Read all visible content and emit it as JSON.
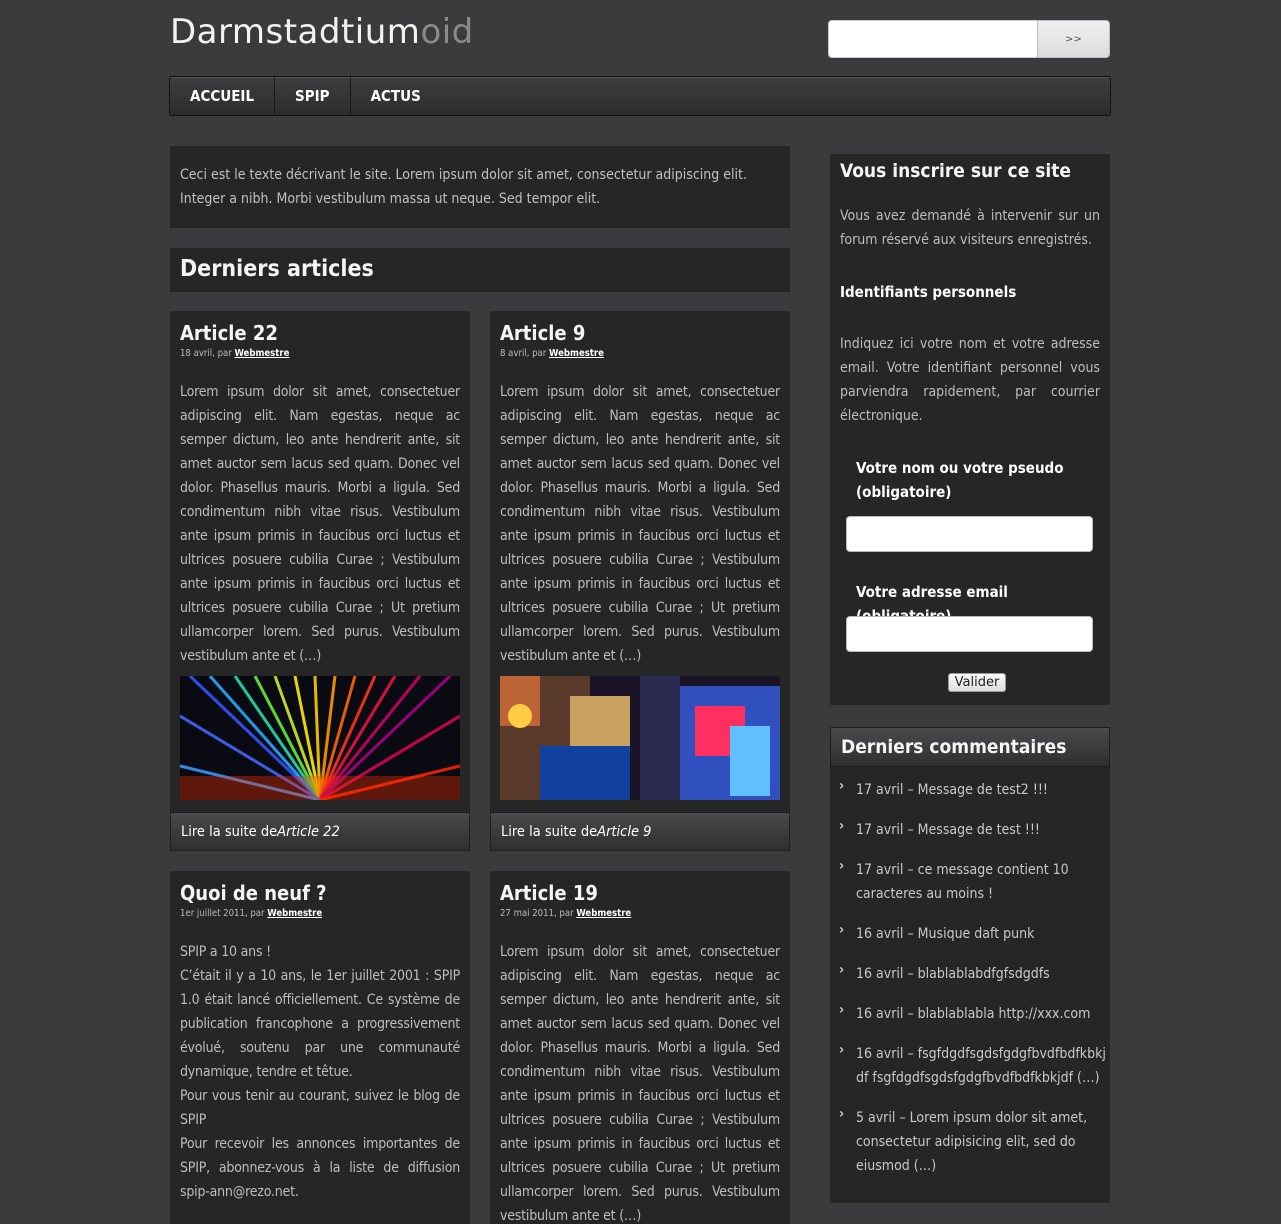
{
  "site": {
    "title_main": "Darmstadtium",
    "title_light": "oid",
    "search_button": ">>"
  },
  "nav": [
    "ACCUEIL",
    "SPIP",
    "ACTUS"
  ],
  "description": "Ceci est le texte décrivant le site. Lorem ipsum dolor sit amet, consectetur adipiscing elit. Integer a nibh. Morbi vestibulum massa ut neque. Sed tempor elit.",
  "section_title": "Derniers articles",
  "articles": [
    {
      "title": "Article 22",
      "date": "18 avril, par ",
      "author": "Webmestre",
      "text": "Lorem ipsum dolor sit amet, consectetuer adipiscing elit. Nam egestas, neque ac semper dictum, leo ante hendrerit ante, sit amet auctor sem lacus sed quam. Donec vel dolor. Phasellus mauris. Morbi a ligula. Sed condimentum nibh vitae risus. Vestibulum ante ipsum primis in faucibus orci luctus et ultrices posuere cubilia Curae ; Vestibulum ante ipsum primis in faucibus orci luctus et ultrices posuere cubilia Curae ; Ut pretium ullamcorper lorem. Sed purus. Vestibulum vestibulum ante et (…)",
      "read_more": "Lire la suite de ",
      "read_more_title": "Article 22"
    },
    {
      "title": "Article 9",
      "date": "8 avril, par ",
      "author": "Webmestre",
      "text": "Lorem ipsum dolor sit amet, consectetuer adipiscing elit. Nam egestas, neque ac semper dictum, leo ante hendrerit ante, sit amet auctor sem lacus sed quam. Donec vel dolor. Phasellus mauris. Morbi a ligula. Sed condimentum nibh vitae risus. Vestibulum ante ipsum primis in faucibus orci luctus et ultrices posuere cubilia Curae ; Vestibulum ante ipsum primis in faucibus orci luctus et ultrices posuere cubilia Curae ; Ut pretium ullamcorper lorem. Sed purus. Vestibulum vestibulum ante et (…)",
      "read_more": "Lire la suite de ",
      "read_more_title": "Article 9"
    },
    {
      "title": "Quoi de neuf ?",
      "date": "1er juillet 2011, par ",
      "author": "Webmestre",
      "text": "SPIP a 10 ans !\nC’était il y a 10 ans, le 1er juillet 2001 : SPIP 1.0 était lancé officiellement. Ce système de publication francophone a progressivement évolué, soutenu par une communauté dynamique, tendre et têtue.\nPour vous tenir au courant, suivez le blog de SPIP\nPour recevoir les annonces importantes de SPIP, abonnez-vous à la liste de diffusion spip-ann@rezo.net."
    },
    {
      "title": "Article 19",
      "date": "27 mai 2011, par ",
      "author": "Webmestre",
      "text": "Lorem ipsum dolor sit amet, consectetuer adipiscing elit. Nam egestas, neque ac semper dictum, leo ante hendrerit ante, sit amet auctor sem lacus sed quam. Donec vel dolor. Phasellus mauris. Morbi a ligula. Sed condimentum nibh vitae risus. Vestibulum ante ipsum primis in faucibus orci luctus et ultrices posuere cubilia Curae ; Vestibulum ante ipsum primis in faucibus orci luctus et ultrices posuere cubilia Curae ; Ut pretium ullamcorper lorem. Sed purus. Vestibulum vestibulum ante et (…)"
    }
  ],
  "signup": {
    "title": "Vous inscrire sur ce site",
    "intro": "Vous avez demandé à intervenir sur un forum réservé aux visiteurs enregistrés.",
    "subtitle": "Identifiants personnels",
    "instructions": "Indiquez ici votre nom et votre adresse email. Votre identifiant personnel vous parviendra rapidement, par courrier électronique.",
    "name_label": "Votre nom ou votre pseudo (obligatoire)",
    "email_label": "Votre adresse email (obligatoire)",
    "submit": "Valider"
  },
  "comments": {
    "title": "Derniers commentaires",
    "items": [
      "17 avril – Message de test2 !!!",
      "17 avril – Message de test !!!",
      "17 avril – ce message contient 10 caracteres au moins !",
      "16 avril – Musique daft punk",
      "16 avril – blablablabdfgfsdgdfs",
      "16 avril – blablablabla http://xxx.com",
      "16 avril – fsgfdgdfsgdsfgdgfbvdfbdfkbkjdf fsgfdgdfsgdsfgdgfbvdfbdfkbkjdf (…)",
      "5 avril – Lorem ipsum dolor sit amet, consectetur adipisicing elit, sed do eiusmod (…)"
    ]
  }
}
